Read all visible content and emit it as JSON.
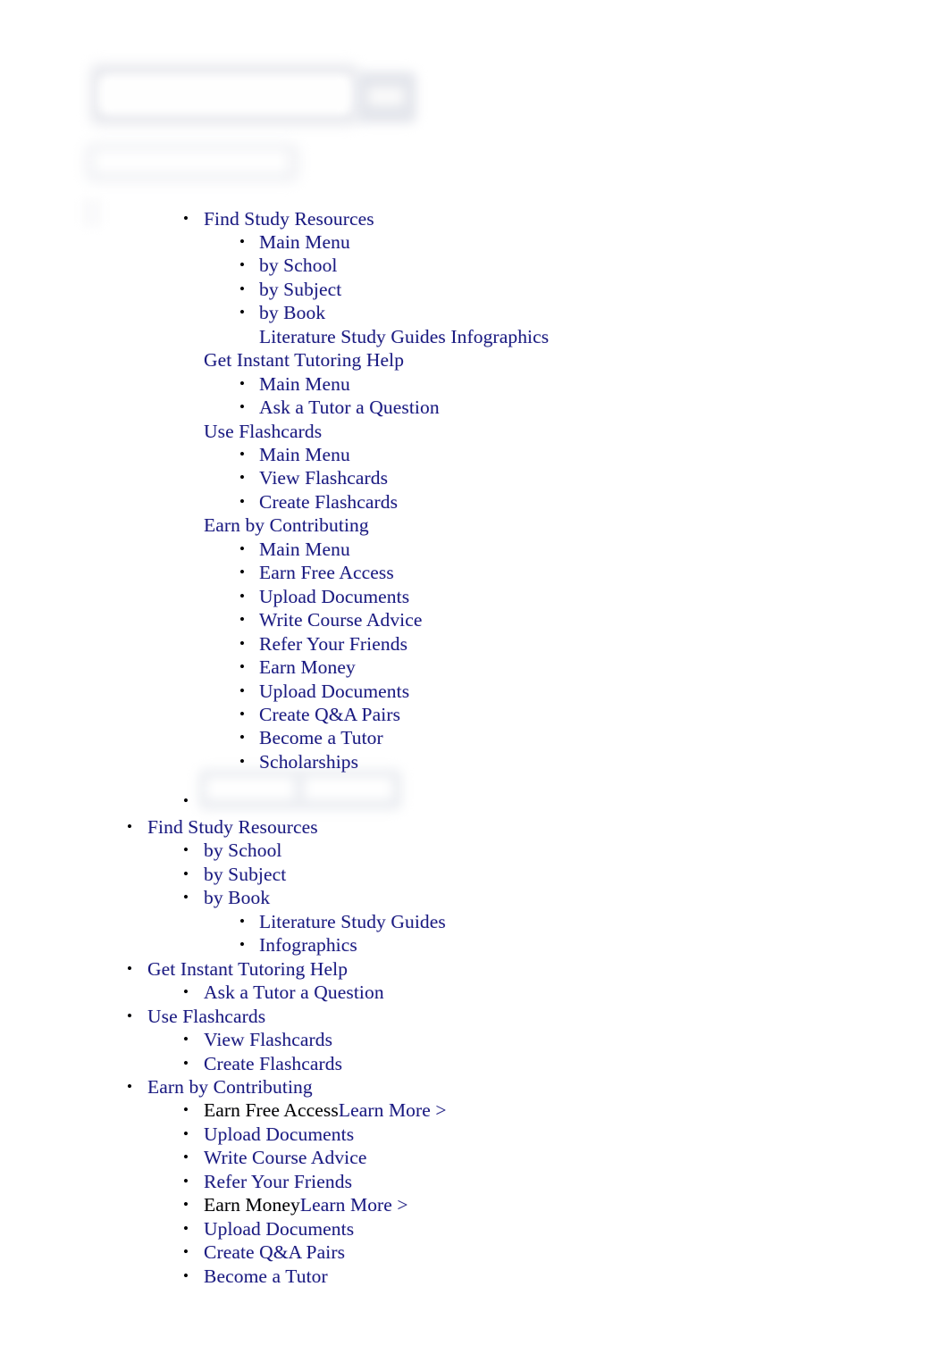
{
  "page": {
    "background_color": "#ffffff",
    "link_color": "#1a1a82",
    "plain_text_color": "#000000"
  },
  "header": {
    "search_input": {
      "value": "",
      "placeholder": ""
    },
    "search_button_label": "",
    "secondary_field": {
      "value": "",
      "placeholder": ""
    }
  },
  "inline_buttons": {
    "left_label": "",
    "right_label": ""
  },
  "menu_primary": {
    "sections": [
      {
        "title": "Find Study Resources",
        "bulleted_title": true,
        "items": [
          {
            "label": "Main Menu",
            "bulleted": true
          },
          {
            "label": "by School",
            "bulleted": true
          },
          {
            "label": "by Subject",
            "bulleted": true
          },
          {
            "label": "by Book",
            "bulleted": true
          },
          {
            "label": "Literature Study Guides Infographics",
            "bulleted": false
          }
        ]
      },
      {
        "title": "Get Instant Tutoring Help",
        "bulleted_title": false,
        "items": [
          {
            "label": "Main Menu",
            "bulleted": true
          },
          {
            "label": "Ask a Tutor a Question",
            "bulleted": true
          }
        ]
      },
      {
        "title": "Use Flashcards",
        "bulleted_title": false,
        "items": [
          {
            "label": "Main Menu",
            "bulleted": true
          },
          {
            "label": "View Flashcards",
            "bulleted": true
          },
          {
            "label": "Create Flashcards",
            "bulleted": true
          }
        ]
      },
      {
        "title": "Earn by Contributing",
        "bulleted_title": false,
        "items": [
          {
            "label": "Main Menu",
            "bulleted": true
          },
          {
            "label": "Earn Free Access",
            "bulleted": true
          },
          {
            "label": "Upload Documents",
            "bulleted": true
          },
          {
            "label": "Write Course Advice",
            "bulleted": true
          },
          {
            "label": "Refer Your Friends",
            "bulleted": true
          },
          {
            "label": "Earn Money",
            "bulleted": true
          },
          {
            "label": "Upload Documents",
            "bulleted": true
          },
          {
            "label": "Create Q&A Pairs",
            "bulleted": true
          },
          {
            "label": "Become a Tutor",
            "bulleted": true
          },
          {
            "label": "Scholarships",
            "bulleted": true
          }
        ]
      }
    ]
  },
  "menu_secondary": {
    "sections": [
      {
        "title": "Find Study Resources",
        "items": [
          {
            "label": "by School"
          },
          {
            "label": "by Subject"
          },
          {
            "label": "by Book",
            "children": [
              {
                "label": "Literature Study Guides"
              },
              {
                "label": "Infographics"
              }
            ]
          }
        ]
      },
      {
        "title": "Get Instant Tutoring Help",
        "items": [
          {
            "label": "Ask a Tutor a Question"
          }
        ]
      },
      {
        "title": "Use Flashcards",
        "items": [
          {
            "label": "View Flashcards"
          },
          {
            "label": "Create Flashcards"
          }
        ]
      },
      {
        "title": "Earn by Contributing",
        "items": [
          {
            "label": "Earn Free Access",
            "suffix": "Learn More >"
          },
          {
            "label": "Upload Documents"
          },
          {
            "label": "Write Course Advice"
          },
          {
            "label": "Refer Your Friends"
          },
          {
            "label": "Earn Money",
            "suffix": "Learn More >"
          },
          {
            "label": "Upload Documents"
          },
          {
            "label": "Create Q&A Pairs"
          },
          {
            "label": "Become a Tutor"
          }
        ]
      }
    ]
  },
  "glyphs": {
    "bullet": "•"
  }
}
